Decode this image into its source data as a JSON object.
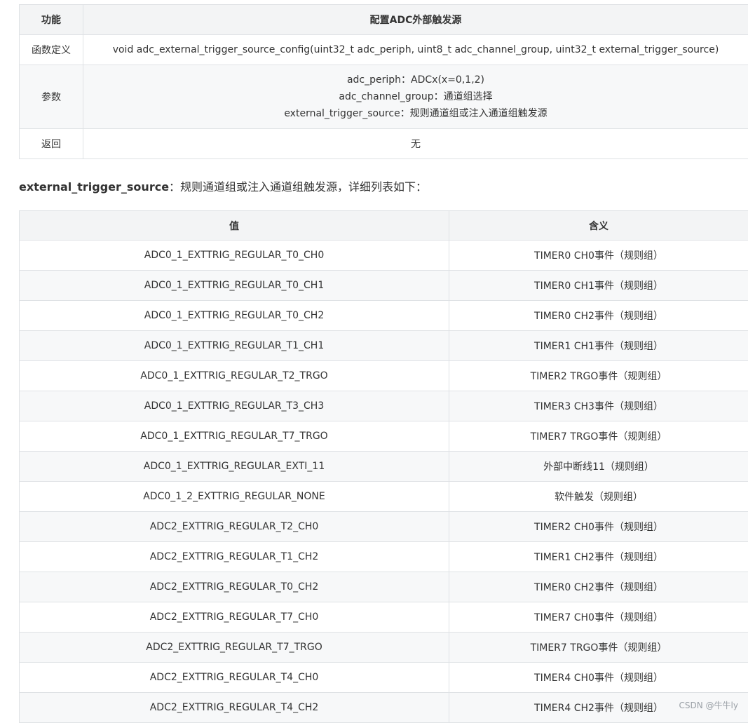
{
  "func_table": {
    "header": {
      "col1": "功能",
      "col2": "配置ADC外部触发源"
    },
    "definition": {
      "label": "函数定义",
      "value": "void adc_external_trigger_source_config(uint32_t adc_periph, uint8_t adc_channel_group, uint32_t external_trigger_source)"
    },
    "params": {
      "label": "参数",
      "lines": [
        "adc_periph：ADCx(x=0,1,2)",
        "adc_channel_group：通道组选择",
        "external_trigger_source：规则通道组或注入通道组触发源"
      ]
    },
    "return": {
      "label": "返回",
      "value": "无"
    }
  },
  "note": {
    "key": "external_trigger_source",
    "text": "：规则通道组或注入通道组触发源，详细列表如下："
  },
  "value_table": {
    "headers": [
      "值",
      "含义"
    ],
    "rows": [
      [
        "ADC0_1_EXTTRIG_REGULAR_T0_CH0",
        "TIMER0 CH0事件（规则组）"
      ],
      [
        "ADC0_1_EXTTRIG_REGULAR_T0_CH1",
        "TIMER0 CH1事件（规则组）"
      ],
      [
        "ADC0_1_EXTTRIG_REGULAR_T0_CH2",
        "TIMER0 CH2事件（规则组）"
      ],
      [
        "ADC0_1_EXTTRIG_REGULAR_T1_CH1",
        "TIMER1 CH1事件（规则组）"
      ],
      [
        "ADC0_1_EXTTRIG_REGULAR_T2_TRGO",
        "TIMER2 TRGO事件（规则组）"
      ],
      [
        "ADC0_1_EXTTRIG_REGULAR_T3_CH3",
        "TIMER3 CH3事件（规则组）"
      ],
      [
        "ADC0_1_EXTTRIG_REGULAR_T7_TRGO",
        "TIMER7 TRGO事件（规则组）"
      ],
      [
        "ADC0_1_EXTTRIG_REGULAR_EXTI_11",
        "外部中断线11（规则组）"
      ],
      [
        "ADC0_1_2_EXTTRIG_REGULAR_NONE",
        "软件触发（规则组）"
      ],
      [
        "ADC2_EXTTRIG_REGULAR_T2_CH0",
        "TIMER2 CH0事件（规则组）"
      ],
      [
        "ADC2_EXTTRIG_REGULAR_T1_CH2",
        "TIMER1 CH2事件（规则组）"
      ],
      [
        "ADC2_EXTTRIG_REGULAR_T0_CH2",
        "TIMER0 CH2事件（规则组）"
      ],
      [
        "ADC2_EXTTRIG_REGULAR_T7_CH0",
        "TIMER7 CH0事件（规则组）"
      ],
      [
        "ADC2_EXTTRIG_REGULAR_T7_TRGO",
        "TIMER7 TRGO事件（规则组）"
      ],
      [
        "ADC2_EXTTRIG_REGULAR_T4_CH0",
        "TIMER4 CH0事件（规则组）"
      ],
      [
        "ADC2_EXTTRIG_REGULAR_T4_CH2",
        "TIMER4 CH2事件（规则组）"
      ]
    ]
  },
  "watermark": "CSDN @牛牛ly",
  "colors": {
    "header_bg": "#f3f4f5",
    "stripe_bg": "#f7f8f9",
    "border": "#dfe2e5",
    "text": "#333333"
  }
}
